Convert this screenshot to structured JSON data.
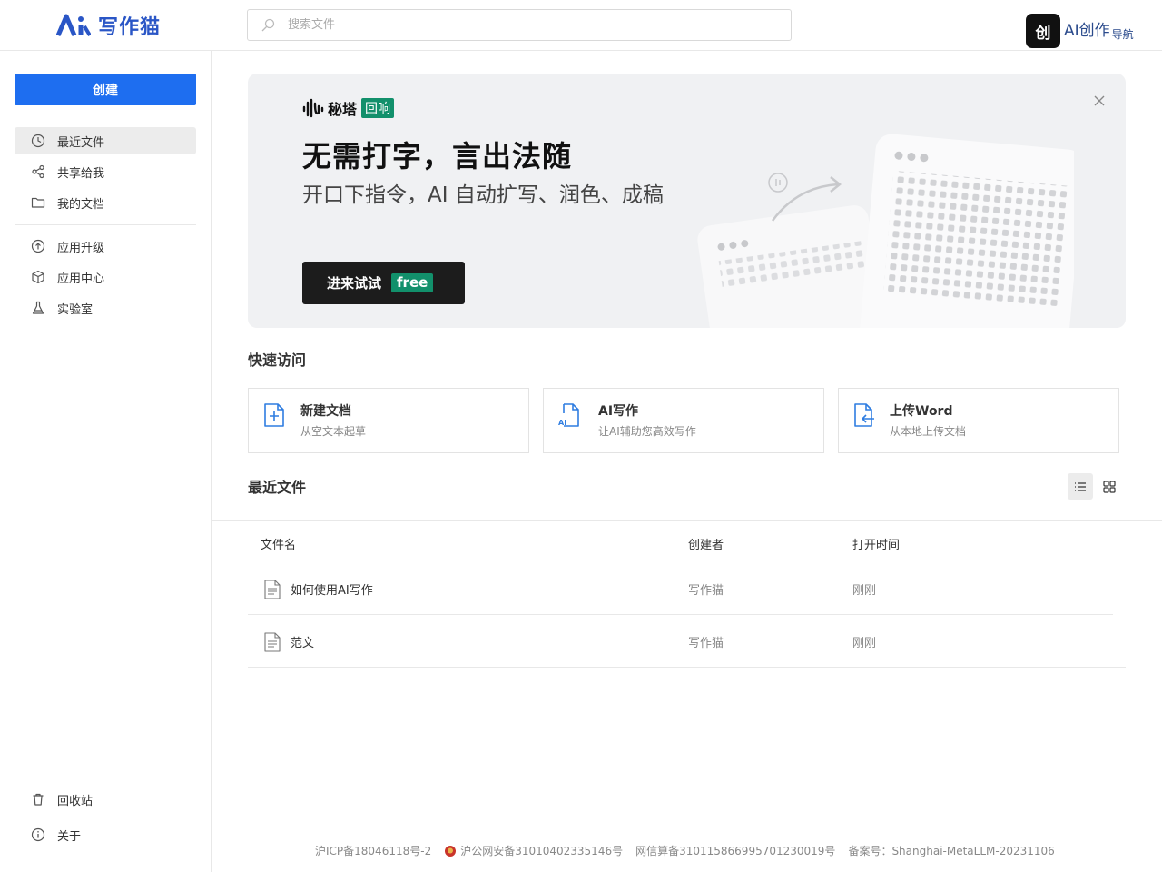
{
  "header": {
    "logo_text": "写作猫",
    "search_placeholder": "搜索文件",
    "watermark_box": "创",
    "watermark_text": "AI创作",
    "watermark_text2": "导航"
  },
  "sidebar": {
    "create_label": "创建",
    "items": [
      {
        "label": "最近文件",
        "icon": "clock-icon"
      },
      {
        "label": "共享给我",
        "icon": "share-icon"
      },
      {
        "label": "我的文档",
        "icon": "folder-icon"
      },
      {
        "label": "应用升级",
        "icon": "upgrade-icon"
      },
      {
        "label": "应用中心",
        "icon": "cube-icon"
      },
      {
        "label": "实验室",
        "icon": "flask-icon"
      }
    ],
    "bottom_items": [
      {
        "label": "回收站",
        "icon": "trash-icon"
      },
      {
        "label": "关于",
        "icon": "info-icon"
      }
    ]
  },
  "banner": {
    "brand_name": "秘塔",
    "brand_tag": "回响",
    "title": "无需打字，言出法随",
    "subtitle": "开口下指令，AI 自动扩写、润色、成稿",
    "button_label": "进来试试",
    "button_tag": "free"
  },
  "quick_access": {
    "title": "快速访问",
    "cards": [
      {
        "title": "新建文档",
        "subtitle": "从空文本起草",
        "icon": "new-doc-icon"
      },
      {
        "title": "AI写作",
        "subtitle": "让AI辅助您高效写作",
        "icon": "ai-doc-icon"
      },
      {
        "title": "上传Word",
        "subtitle": "从本地上传文档",
        "icon": "upload-doc-icon"
      }
    ]
  },
  "recent": {
    "title": "最近文件",
    "columns": [
      "文件名",
      "创建者",
      "打开时间"
    ],
    "rows": [
      {
        "name": "如何使用AI写作",
        "creator": "写作猫",
        "time": "刚刚"
      },
      {
        "name": "范文",
        "creator": "写作猫",
        "time": "刚刚"
      }
    ]
  },
  "footer": {
    "icp": "沪ICP备18046118号-2",
    "police": "沪公网安备31010402335146号",
    "algo": "网信算备310115866995701230019号",
    "record": "备案号：Shanghai-MetaLLM-20231106"
  },
  "colors": {
    "accent": "#1e6ef0",
    "brand_green": "#12906b",
    "logo_blue": "#2a56c6"
  }
}
